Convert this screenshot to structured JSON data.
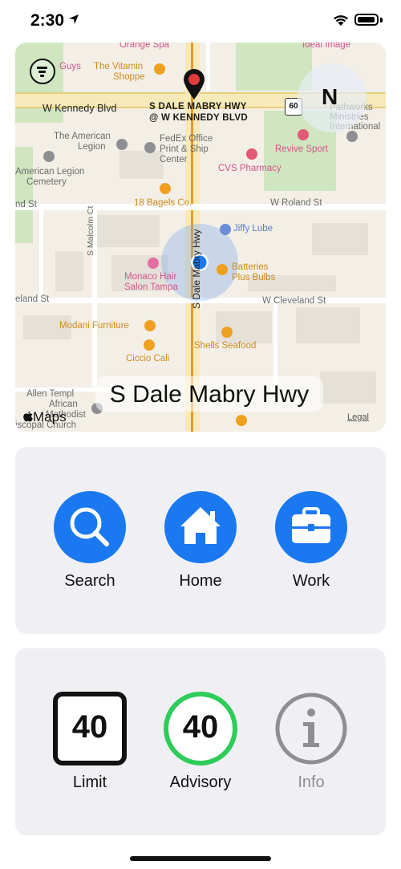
{
  "status_bar": {
    "time": "2:30"
  },
  "map": {
    "street_banner": "S Dale Mabry Hwy",
    "compass": "N",
    "brand": "Maps",
    "legal": "Legal",
    "marker_label_line1": "S DALE MABRY HWY",
    "marker_label_line2": "@ W KENNEDY BLVD",
    "route_shield": "60",
    "labels": {
      "guys": "Guys",
      "vitamin1": "The Vitamin",
      "vitamin2": "Shoppe",
      "orange_spa": "Orange Spa",
      "ideal_image": "Ideal Image",
      "kennedy": "W Kennedy Blvd",
      "pathworks1": "Pathworks",
      "pathworks2": "Ministries",
      "pathworks3": "International",
      "legion1": "The American",
      "legion2": "Legion",
      "fedex1": "FedEx Office",
      "fedex2": "Print & Ship",
      "fedex3": "Center",
      "revive": "Revive Sport",
      "cemetery1": "American Legion",
      "cemetery2": "Cemetery",
      "cvs": "CVS Pharmacy",
      "bagels": "18 Bagels Co.",
      "roland_w": "W Roland St",
      "roland_e": "nd St",
      "jiffy": "Jiffy Lube",
      "malcolm": "S Malcolm Ct",
      "dale_vertical": "S Dale Mabry Hwy",
      "monaco1": "Monaco Hair",
      "monaco2": "Salon Tampa",
      "batteries1": "Batteries",
      "batteries2": "Plus Bulbs",
      "cleveland_w": "eland St",
      "cleveland_e": "W Cleveland St",
      "modani": "Modani Furniture",
      "shells": "Shells Seafood",
      "ciccio": "Ciccio Cali",
      "allen1": "Allen Templ",
      "allen2": "African",
      "allen3": "Methodist",
      "allen4": "iscopal Church"
    }
  },
  "quick_actions": [
    {
      "label": "Search",
      "icon": "magnifying-glass-icon"
    },
    {
      "label": "Home",
      "icon": "house-icon"
    },
    {
      "label": "Work",
      "icon": "briefcase-icon"
    }
  ],
  "speed": {
    "limit_value": "40",
    "limit_label": "Limit",
    "advisory_value": "40",
    "advisory_label": "Advisory",
    "info_label": "Info"
  },
  "colors": {
    "accent_blue": "#1a78f0",
    "advisory_green": "#2ecc59",
    "info_gray": "#8e8e93",
    "panel_bg": "#f0f0f4"
  }
}
